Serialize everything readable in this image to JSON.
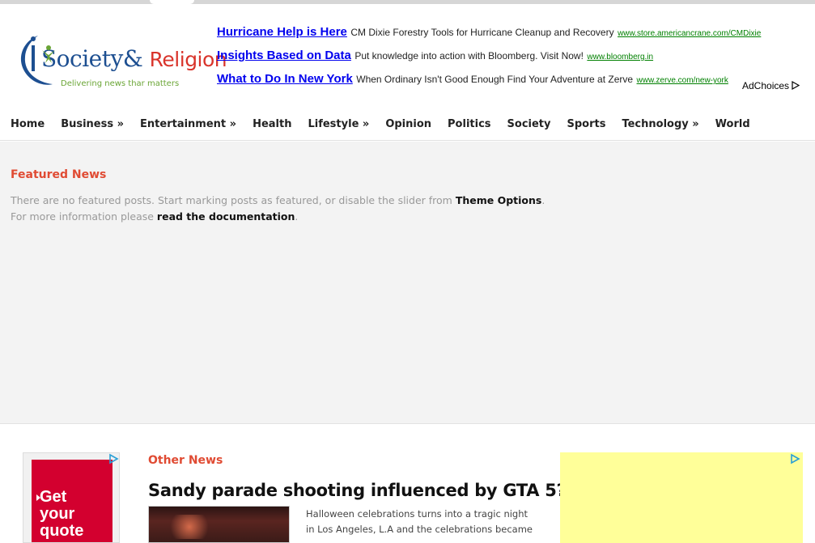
{
  "logo": {
    "brand_main": "Society",
    "brand_amp": "&",
    "brand_rel": "Religion",
    "tagline": "Delivering news thar matters"
  },
  "ads": [
    {
      "title": "Hurricane Help is Here",
      "desc": "CM Dixie Forestry Tools for Hurricane Cleanup and Recovery",
      "url": "www.store.americancrane.com/CMDixie"
    },
    {
      "title": "Insights Based on Data",
      "desc": "Put knowledge into action with Bloomberg. Visit Now!",
      "url": "www.bloomberg.in"
    },
    {
      "title": "What to Do In New York",
      "desc": "When Ordinary Isn't Good Enough Find Your Adventure at Zerve",
      "url": "www.zerve.com/new-york"
    }
  ],
  "adchoices": "AdChoices",
  "nav": [
    "Home",
    "Business »",
    "Entertainment »",
    "Health",
    "Lifestyle »",
    "Opinion",
    "Politics",
    "Society",
    "Sports",
    "Technology »",
    "World"
  ],
  "featured": {
    "heading": "Featured News",
    "line1_pre": "There are no featured posts. Start marking posts as featured, or disable the slider from ",
    "line1_link": "Theme Options",
    "line1_post": ".",
    "line2_pre": "For more information please ",
    "line2_link": "read the documentation",
    "line2_post": "."
  },
  "left_ad": {
    "text": "Get your quote"
  },
  "other_news": {
    "heading": "Other News",
    "article_title": "Sandy parade shooting influenced by GTA 5?",
    "excerpt": "Halloween celebrations turns into a tragic night in Los Angeles, L.A and the celebrations became"
  },
  "colors": {
    "accent": "#e04b33",
    "ad_link": "#0000ee",
    "ad_url": "#008000",
    "featured_bg": "#f3f3f3",
    "yellow_ad": "#ffff99"
  }
}
